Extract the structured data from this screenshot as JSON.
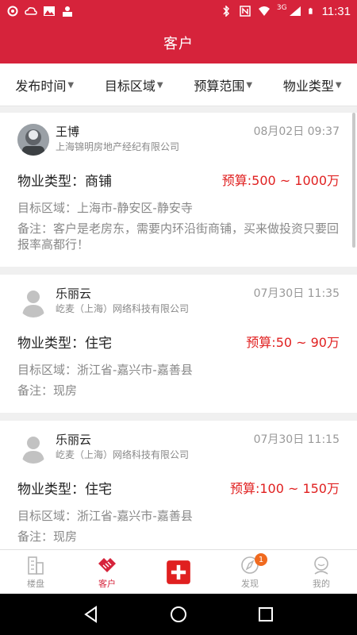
{
  "status_bar": {
    "time": "11:31",
    "network": "3G"
  },
  "header": {
    "title": "客户"
  },
  "filters": [
    {
      "label": "发布时间"
    },
    {
      "label": "目标区域"
    },
    {
      "label": "预算范围"
    },
    {
      "label": "物业类型"
    }
  ],
  "customers": [
    {
      "name": "王博",
      "company": "上海锦明房地产经纪有限公司",
      "date": "08月02日 09:37",
      "property_type": "物业类型：商铺",
      "budget": "预算:500 ~ 1000万",
      "region": "目标区域：上海市-静安区-静安寺",
      "note": "备注：客户是老房东，需要内环沿街商铺，买来做投资只要回报率高都行！",
      "avatar": "photo"
    },
    {
      "name": "乐丽云",
      "company": "屹麦（上海）网络科技有限公司",
      "date": "07月30日 11:35",
      "property_type": "物业类型：住宅",
      "budget": "预算:50 ~ 90万",
      "region": "目标区域：浙江省-嘉兴市-嘉善县",
      "note": "备注：现房",
      "avatar": "default"
    },
    {
      "name": "乐丽云",
      "company": "屹麦（上海）网络科技有限公司",
      "date": "07月30日 11:15",
      "property_type": "物业类型：住宅",
      "budget": "预算:100 ~ 150万",
      "region": "目标区域：浙江省-嘉兴市-嘉善县",
      "note": "备注：现房",
      "avatar": "default"
    }
  ],
  "tabbar": [
    {
      "label": "楼盘",
      "icon": "building-icon",
      "active": false
    },
    {
      "label": "客户",
      "icon": "handshake-icon",
      "active": true
    },
    {
      "label": "",
      "icon": "add-icon",
      "active": false
    },
    {
      "label": "发现",
      "icon": "compass-icon",
      "active": false,
      "badge": "1"
    },
    {
      "label": "我的",
      "icon": "profile-icon",
      "active": false
    }
  ],
  "colors": {
    "brand": "#d6233b",
    "budget": "#e02020",
    "badge": "#f06a1f"
  }
}
